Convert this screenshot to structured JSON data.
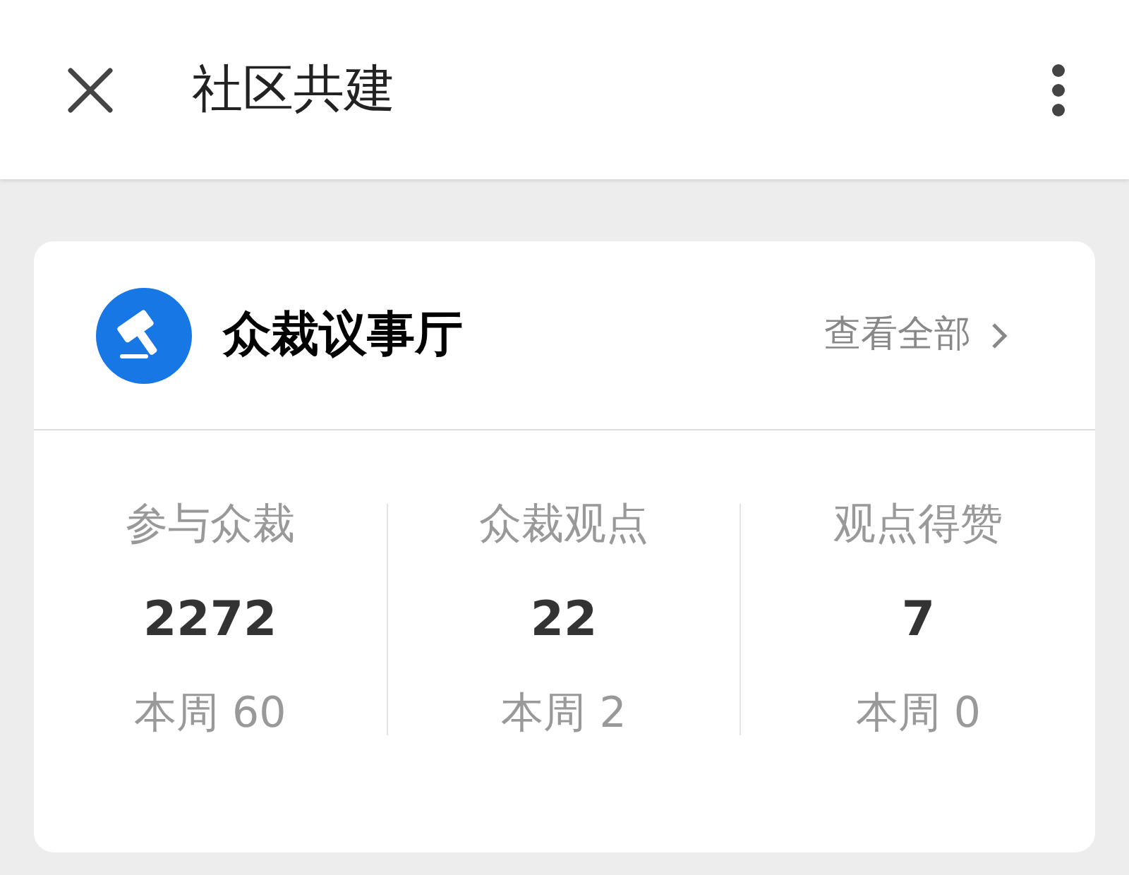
{
  "header": {
    "title": "社区共建"
  },
  "card": {
    "title": "众裁议事厅",
    "link": "查看全部",
    "stats": [
      {
        "label": "参与众裁",
        "value": "2272",
        "weekly": "本周 60"
      },
      {
        "label": "众裁观点",
        "value": "22",
        "weekly": "本周 2"
      },
      {
        "label": "观点得赞",
        "value": "7",
        "weekly": "本周 0"
      }
    ]
  }
}
